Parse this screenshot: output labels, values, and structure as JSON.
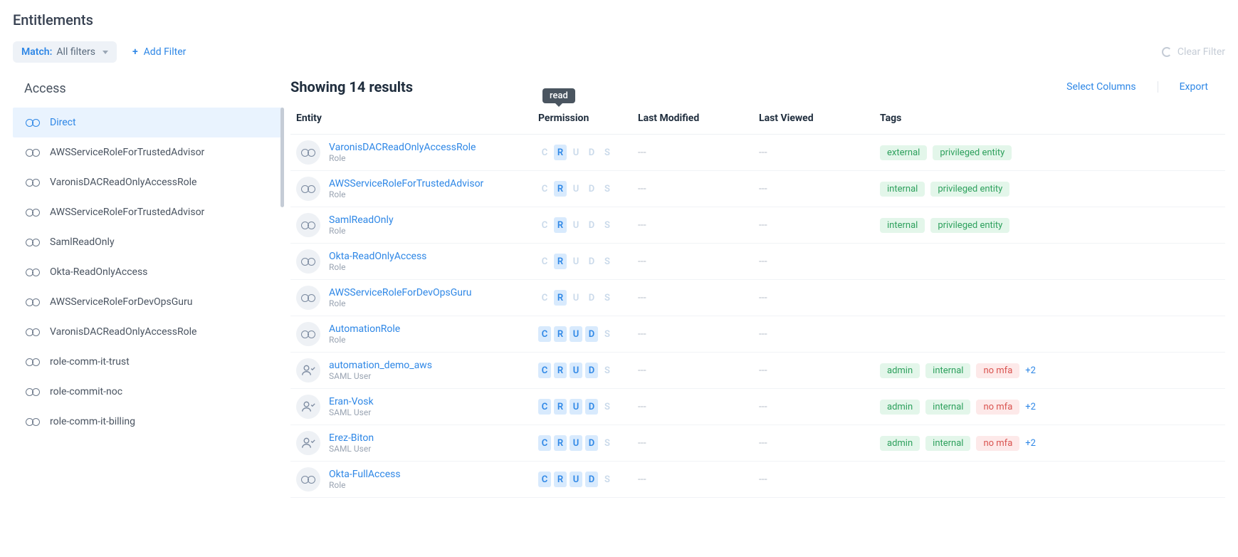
{
  "title": "Entitlements",
  "filterBar": {
    "matchLabel": "Match:",
    "matchValue": "All filters",
    "addFilter": "Add Filter",
    "clearFilter": "Clear Filter"
  },
  "sidebar": {
    "title": "Access",
    "items": [
      {
        "label": "Direct",
        "active": true
      },
      {
        "label": "AWSServiceRoleForTrustedAdvisor"
      },
      {
        "label": "VaronisDACReadOnlyAccessRole"
      },
      {
        "label": "AWSServiceRoleForTrustedAdvisor"
      },
      {
        "label": "SamlReadOnly"
      },
      {
        "label": "Okta-ReadOnlyAccess"
      },
      {
        "label": "AWSServiceRoleForDevOpsGuru"
      },
      {
        "label": "VaronisDACReadOnlyAccessRole"
      },
      {
        "label": "role-comm-it-trust"
      },
      {
        "label": "role-commit-noc"
      },
      {
        "label": "role-comm-it-billing"
      }
    ]
  },
  "results": {
    "text": "Showing 14 results",
    "selectColumns": "Select Columns",
    "export": "Export"
  },
  "columns": {
    "entity": "Entity",
    "permission": "Permission",
    "lastModified": "Last Modified",
    "lastViewed": "Last Viewed",
    "tags": "Tags"
  },
  "tooltip": "read",
  "permissionLetters": [
    "C",
    "R",
    "U",
    "D",
    "S"
  ],
  "emptyDash": "---",
  "rows": [
    {
      "name": "VaronisDACReadOnlyAccessRole",
      "sub": "Role",
      "iconType": "role",
      "perm": "r_only",
      "tags": [
        {
          "t": "external",
          "c": "green"
        },
        {
          "t": "privileged entity",
          "c": "green"
        }
      ]
    },
    {
      "name": "AWSServiceRoleForTrustedAdvisor",
      "sub": "Role",
      "iconType": "role",
      "perm": "r_only",
      "tags": [
        {
          "t": "internal",
          "c": "green"
        },
        {
          "t": "privileged entity",
          "c": "green"
        }
      ]
    },
    {
      "name": "SamlReadOnly",
      "sub": "Role",
      "iconType": "role",
      "perm": "r_only",
      "tags": [
        {
          "t": "internal",
          "c": "green"
        },
        {
          "t": "privileged entity",
          "c": "green"
        }
      ]
    },
    {
      "name": "Okta-ReadOnlyAccess",
      "sub": "Role",
      "iconType": "role",
      "perm": "r_only",
      "tags": []
    },
    {
      "name": "AWSServiceRoleForDevOpsGuru",
      "sub": "Role",
      "iconType": "role",
      "perm": "r_only",
      "tags": []
    },
    {
      "name": "AutomationRole",
      "sub": "Role",
      "iconType": "role",
      "perm": "crud",
      "tags": []
    },
    {
      "name": "automation_demo_aws",
      "sub": "SAML User",
      "iconType": "user",
      "perm": "crud",
      "tags": [
        {
          "t": "admin",
          "c": "green"
        },
        {
          "t": "internal",
          "c": "green"
        },
        {
          "t": "no mfa",
          "c": "red"
        }
      ],
      "more": "+2"
    },
    {
      "name": "Eran-Vosk",
      "sub": "SAML User",
      "iconType": "user",
      "perm": "crud",
      "tags": [
        {
          "t": "admin",
          "c": "green"
        },
        {
          "t": "internal",
          "c": "green"
        },
        {
          "t": "no mfa",
          "c": "red"
        }
      ],
      "more": "+2"
    },
    {
      "name": "Erez-Biton",
      "sub": "SAML User",
      "iconType": "user",
      "perm": "crud",
      "tags": [
        {
          "t": "admin",
          "c": "green"
        },
        {
          "t": "internal",
          "c": "green"
        },
        {
          "t": "no mfa",
          "c": "red"
        }
      ],
      "more": "+2"
    },
    {
      "name": "Okta-FullAccess",
      "sub": "Role",
      "iconType": "role",
      "perm": "crud",
      "tags": []
    }
  ]
}
